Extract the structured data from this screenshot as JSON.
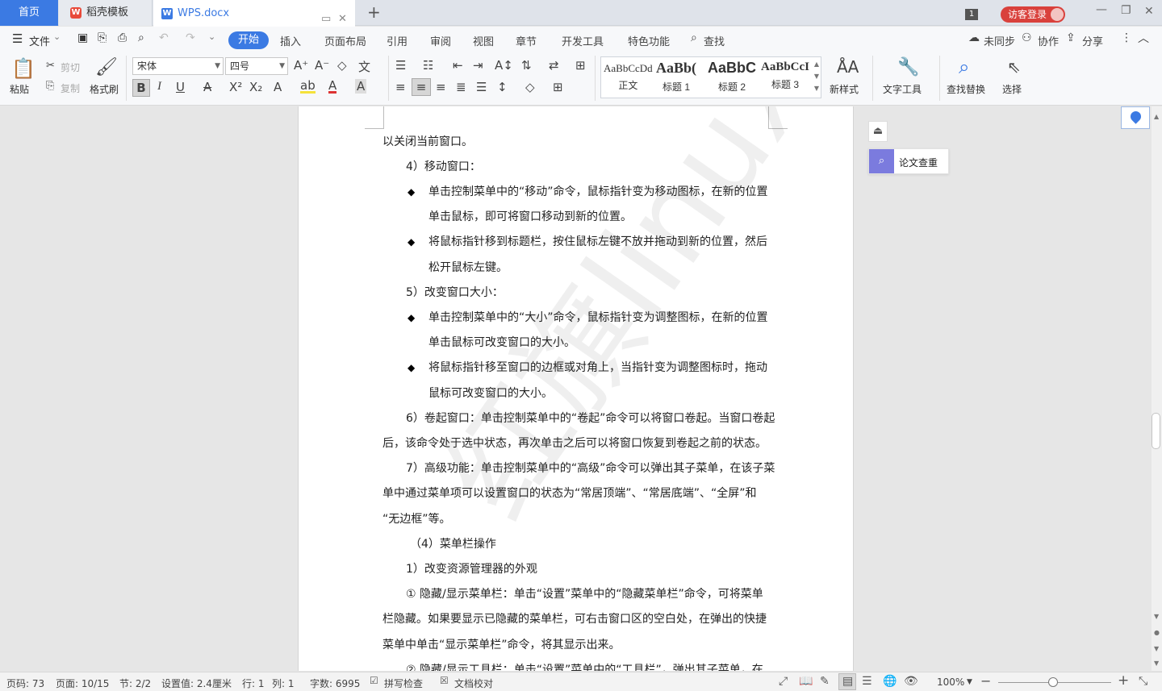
{
  "tabs": {
    "home": "首页",
    "template": "稻壳模板",
    "doc": "WPS.docx",
    "window_count": "1",
    "login": "访客登录"
  },
  "menu": {
    "file": "文件",
    "items": [
      "开始",
      "插入",
      "页面布局",
      "引用",
      "审阅",
      "视图",
      "章节",
      "开发工具",
      "特色功能",
      "查找"
    ],
    "sync": "未同步",
    "collab": "协作",
    "share": "分享"
  },
  "ribbon": {
    "paste": "粘贴",
    "cut": "剪切",
    "copy": "复制",
    "format_painter": "格式刷",
    "font_name": "宋体",
    "font_size": "四号",
    "styles": [
      {
        "sample": "AaBbCcDd",
        "name": "正文"
      },
      {
        "sample": "AaBb(",
        "name": "标题 1"
      },
      {
        "sample": "AaBbC",
        "name": "标题 2"
      },
      {
        "sample": "AaBbCcI",
        "name": "标题 3"
      }
    ],
    "new_style": "新样式",
    "text_tools": "文字工具",
    "find_replace": "查找替换",
    "select": "选择"
  },
  "document": {
    "paragraphs": [
      "以关闭当前窗口。",
      "4）移动窗口：",
      "单击控制菜单中的“移动”命令，鼠标指针变为移动图标，在新的位置",
      "单击鼠标，即可将窗口移动到新的位置。",
      "将鼠标指针移到标题栏，按住鼠标左键不放并拖动到新的位置，然后",
      "松开鼠标左键。",
      "5）改变窗口大小：",
      "单击控制菜单中的“大小”命令，鼠标指针变为调整图标，在新的位置",
      "单击鼠标可改变窗口的大小。",
      "将鼠标指针移至窗口的边框或对角上，当指针变为调整图标时，拖动",
      "鼠标可改变窗口的大小。",
      "6）卷起窗口：单击控制菜单中的“卷起”命令可以将窗口卷起。当窗口卷起",
      "后，该命令处于选中状态，再次单击之后可以将窗口恢复到卷起之前的状态。",
      "7）高级功能：单击控制菜单中的“高级”命令可以弹出其子菜单，在该子菜",
      "单中通过菜单项可以设置窗口的状态为“常居顶端”、“常居底端”、“全屏”和",
      "“无边框”等。",
      "（4）菜单栏操作",
      "1）改变资源管理器的外观",
      "① 隐藏/显示菜单栏：单击“设置”菜单中的“隐藏菜单栏”命令，可将菜单",
      "栏隐藏。如果要显示已隐藏的菜单栏，可右击窗口区的空白处，在弹出的快捷",
      "菜单中单击“显示菜单栏”命令，将其显示出来。",
      "② 隐藏/显示工具栏：单击“设置”菜单中的“工具栏”，弹出其子菜单，在"
    ],
    "watermark": "红旗linux"
  },
  "side": {
    "thesis": "论文查重"
  },
  "status": {
    "page_code": "页码: 73",
    "page": "页面: 10/15",
    "section": "节: 2/2",
    "setting": "设置值: 2.4厘米",
    "row": "行: 1",
    "col": "列: 1",
    "words": "字数: 6995",
    "spell": "拼写检查",
    "proof": "文档校对",
    "zoom": "100%"
  }
}
